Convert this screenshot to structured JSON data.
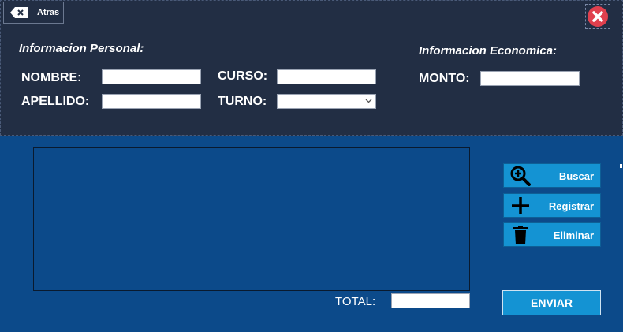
{
  "header": {
    "back_label": "Atras"
  },
  "personal": {
    "title": "Informacion Personal:",
    "nombre_label": "NOMBRE:",
    "nombre_value": "",
    "apellido_label": "APELLIDO:",
    "apellido_value": "",
    "curso_label": "CURSO:",
    "curso_value": "",
    "turno_label": "TURNO:",
    "turno_value": ""
  },
  "economica": {
    "title": "Informacion Economica:",
    "monto_label": "MONTO:",
    "monto_value": ""
  },
  "actions": {
    "buscar": "Buscar",
    "registrar": "Registrar",
    "eliminar": "Eliminar"
  },
  "footer": {
    "total_label": "TOTAL:",
    "total_value": "",
    "enviar": "ENVIAR"
  },
  "colors": {
    "header_bg": "#222e44",
    "body_bg": "#0c4a8a",
    "button_bg": "#1493d3",
    "close_red": "#e0404e"
  }
}
